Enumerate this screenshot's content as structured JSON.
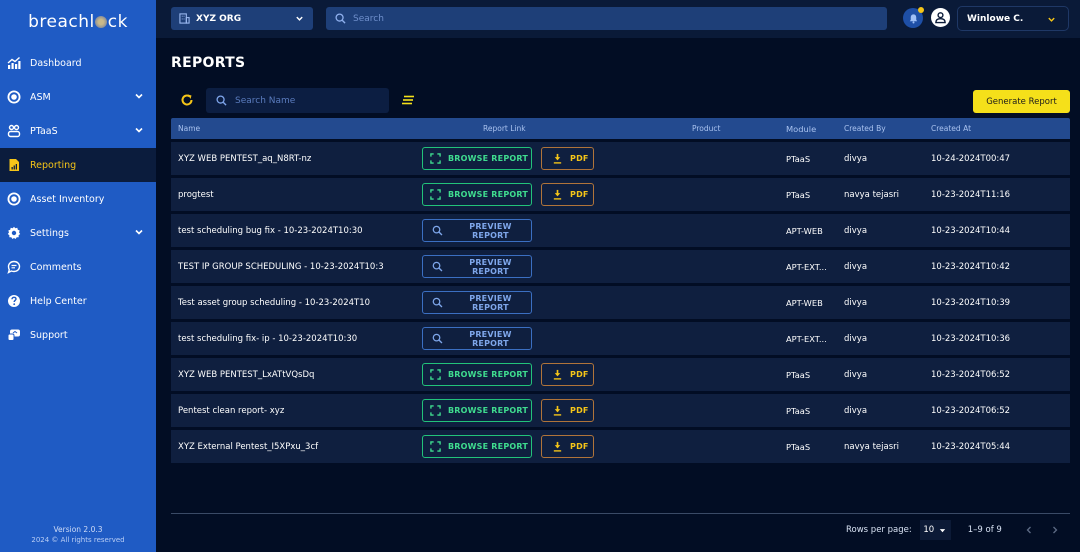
{
  "app": {
    "brand": "breachlock"
  },
  "sidebar": {
    "items": [
      {
        "label": "Dashboard",
        "icon": "chart-icon",
        "expandable": false,
        "active": false
      },
      {
        "label": "ASM",
        "icon": "target-icon",
        "expandable": true,
        "active": false
      },
      {
        "label": "PTaaS",
        "icon": "users-icon",
        "expandable": true,
        "active": false
      },
      {
        "label": "Reporting",
        "icon": "report-icon",
        "expandable": false,
        "active": true
      },
      {
        "label": "Asset Inventory",
        "icon": "target-icon",
        "expandable": false,
        "active": false
      },
      {
        "label": "Settings",
        "icon": "gear-icon",
        "expandable": true,
        "active": false
      },
      {
        "label": "Comments",
        "icon": "comment-icon",
        "expandable": false,
        "active": false
      },
      {
        "label": "Help Center",
        "icon": "help-icon",
        "expandable": false,
        "active": false
      },
      {
        "label": "Support",
        "icon": "support-icon",
        "expandable": false,
        "active": false
      }
    ],
    "version": "Version 2.0.3",
    "copyright": "2024 © All rights reserved"
  },
  "topbar": {
    "org": "XYZ ORG",
    "search_placeholder": "Search",
    "user_name": "Winlowe C.",
    "has_notification": true
  },
  "page": {
    "title": "REPORTS",
    "search_placeholder": "Search Name",
    "generate_label": "Generate Report"
  },
  "table": {
    "columns": [
      "Name",
      "Report Link",
      "Product",
      "Module",
      "Created By",
      "Created At"
    ],
    "browse_label": "BROWSE REPORT",
    "preview_label": "PREVIEW REPORT",
    "pdf_label": "PDF",
    "rows": [
      {
        "name": "XYZ WEB PENTEST_aq_N8RT-nz",
        "link_type": "browse",
        "pdf": true,
        "product": "",
        "module": "PTaaS",
        "created_by": "divya",
        "created_at": "10-24-2024T00:47"
      },
      {
        "name": "progtest",
        "link_type": "browse",
        "pdf": true,
        "product": "",
        "module": "PTaaS",
        "created_by": "navya tejasri",
        "created_at": "10-23-2024T11:16"
      },
      {
        "name": "test scheduling bug fix - 10-23-2024T10:30",
        "link_type": "preview",
        "pdf": false,
        "product": "",
        "module": "APT-WEB",
        "created_by": "divya",
        "created_at": "10-23-2024T10:44"
      },
      {
        "name": "TEST IP GROUP SCHEDULING - 10-23-2024T10:3",
        "link_type": "preview",
        "pdf": false,
        "product": "",
        "module": "APT-EXT...",
        "created_by": "divya",
        "created_at": "10-23-2024T10:42"
      },
      {
        "name": "Test asset group scheduling - 10-23-2024T10",
        "link_type": "preview",
        "pdf": false,
        "product": "",
        "module": "APT-WEB",
        "created_by": "divya",
        "created_at": "10-23-2024T10:39"
      },
      {
        "name": "test scheduling fix- ip - 10-23-2024T10:30",
        "link_type": "preview",
        "pdf": false,
        "product": "",
        "module": "APT-EXT...",
        "created_by": "divya",
        "created_at": "10-23-2024T10:36"
      },
      {
        "name": "XYZ WEB PENTEST_LxATtVQsDq",
        "link_type": "browse",
        "pdf": true,
        "product": "",
        "module": "PTaaS",
        "created_by": "divya",
        "created_at": "10-23-2024T06:52"
      },
      {
        "name": "Pentest clean report- xyz",
        "link_type": "browse",
        "pdf": true,
        "product": "",
        "module": "PTaaS",
        "created_by": "divya",
        "created_at": "10-23-2024T06:52"
      },
      {
        "name": "XYZ External Pentest_I5XPxu_3cf",
        "link_type": "browse",
        "pdf": true,
        "product": "",
        "module": "PTaaS",
        "created_by": "navya tejasri",
        "created_at": "10-23-2024T05:44"
      }
    ]
  },
  "pagination": {
    "rows_per_page_label": "Rows per page:",
    "rows_per_page": "10",
    "range": "1–9 of 9"
  },
  "colors": {
    "sidebar_bg": "#1f5bc4",
    "accent_yellow": "#f5c518",
    "browse_green": "#22c27a",
    "preview_blue": "#3b6fc2",
    "pdf_orange": "#b0743a"
  }
}
